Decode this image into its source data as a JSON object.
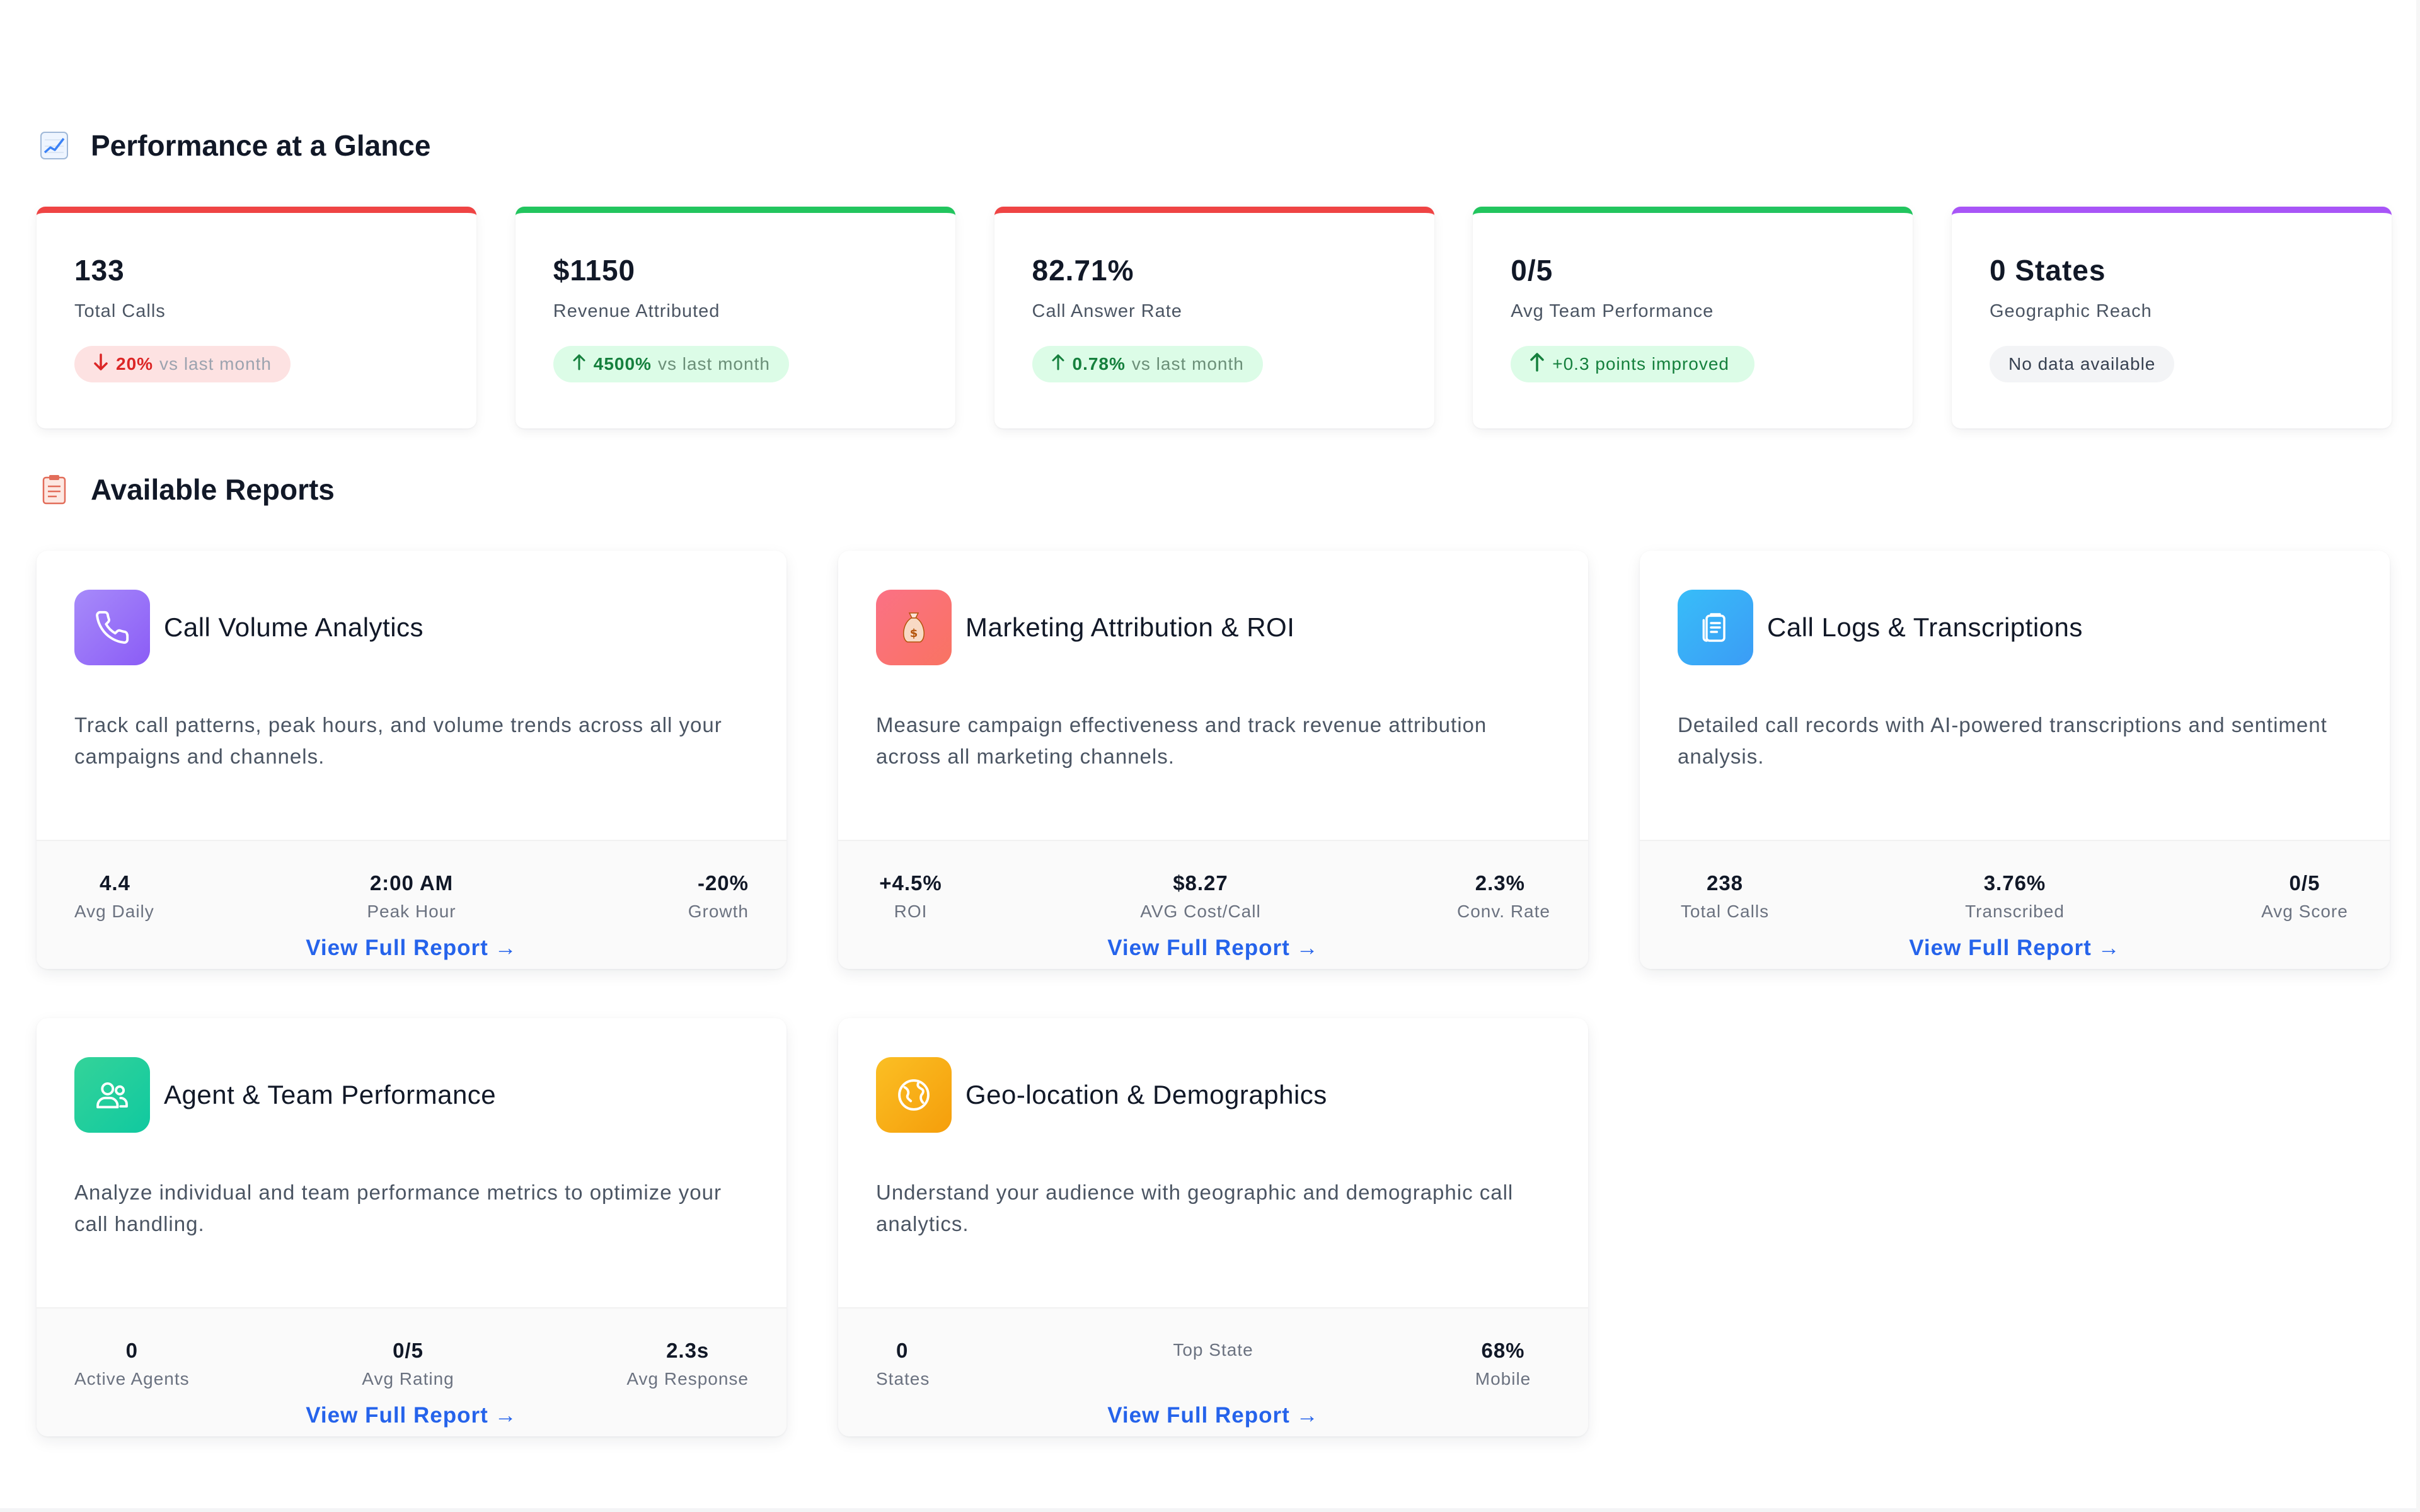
{
  "performance": {
    "title": "Performance at a Glance",
    "icon": "chart-increasing-icon",
    "kpis": [
      {
        "value": "133",
        "label": "Total Calls",
        "trend": "down",
        "delta": "20%",
        "suffix": "vs last month",
        "accent": "#ef4444"
      },
      {
        "value": "$1150",
        "label": "Revenue Attributed",
        "trend": "up",
        "delta": "4500%",
        "suffix": "vs last month",
        "accent": "#22c55e"
      },
      {
        "value": "82.71%",
        "label": "Call Answer Rate",
        "trend": "up",
        "delta": "0.78%",
        "suffix": "vs last month",
        "accent": "#ef4444"
      },
      {
        "value": "0/5",
        "label": "Avg Team Performance",
        "trend": "up",
        "delta": "+0.3 points improved",
        "suffix": "",
        "accent": "#22c55e"
      },
      {
        "value": "0 States",
        "label": "Geographic Reach",
        "trend": "none",
        "delta": "No data available",
        "suffix": "",
        "accent": "#a855f7"
      }
    ]
  },
  "reports": {
    "title": "Available Reports",
    "icon": "clipboard-icon",
    "view_label": "View Full Report",
    "items": [
      {
        "title": "Call Volume Analytics",
        "icon": "phone-icon",
        "description": "Track call patterns, peak hours, and volume trends across all your campaigns and channels.",
        "stats": [
          {
            "value": "4.4",
            "label": "Avg Daily"
          },
          {
            "value": "2:00 AM",
            "label": "Peak Hour"
          },
          {
            "value": "-20%",
            "label": "Growth"
          }
        ]
      },
      {
        "title": "Marketing Attribution & ROI",
        "icon": "money-bag-icon",
        "description": "Measure campaign effectiveness and track revenue attribution across all marketing channels.",
        "stats": [
          {
            "value": "+4.5%",
            "label": "ROI"
          },
          {
            "value": "$8.27",
            "label": "AVG Cost/Call"
          },
          {
            "value": "2.3%",
            "label": "Conv. Rate"
          }
        ]
      },
      {
        "title": "Call Logs & Transcriptions",
        "icon": "document-icon",
        "description": "Detailed call records with AI-powered transcriptions and sentiment analysis.",
        "stats": [
          {
            "value": "238",
            "label": "Total Calls"
          },
          {
            "value": "3.76%",
            "label": "Transcribed"
          },
          {
            "value": "0/5",
            "label": "Avg Score"
          }
        ]
      },
      {
        "title": "Agent & Team Performance",
        "icon": "users-icon",
        "description": "Analyze individual and team performance metrics to optimize your call handling.",
        "stats": [
          {
            "value": "0",
            "label": "Active Agents"
          },
          {
            "value": "0/5",
            "label": "Avg Rating"
          },
          {
            "value": "2.3s",
            "label": "Avg Response"
          }
        ]
      },
      {
        "title": "Geo-location & Demographics",
        "icon": "globe-icon",
        "description": "Understand your audience with geographic and demographic call analytics.",
        "stats": [
          {
            "value": "0",
            "label": "States"
          },
          {
            "value": "",
            "label": "Top State"
          },
          {
            "value": "68%",
            "label": "Mobile"
          }
        ]
      }
    ]
  }
}
